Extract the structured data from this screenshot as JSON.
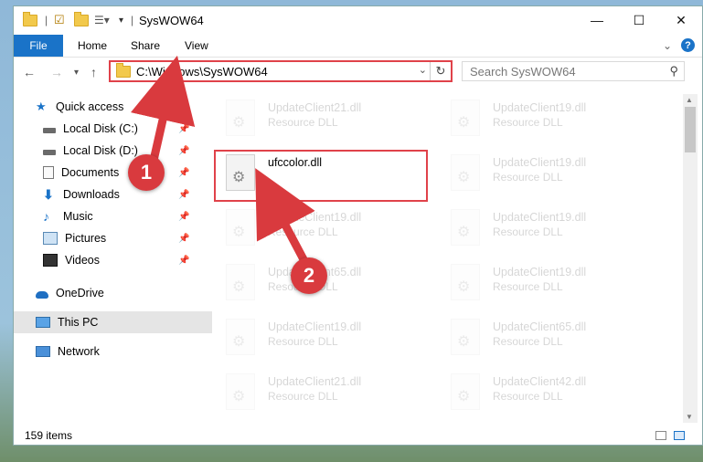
{
  "window": {
    "title": "SysWOW64",
    "controls": {
      "minimize": "—",
      "maximize": "☐",
      "close": "✕"
    }
  },
  "ribbon": {
    "tabs": [
      "File",
      "Home",
      "Share",
      "View"
    ]
  },
  "nav": {
    "address": "C:\\Windows\\SysWOW64",
    "search_placeholder": "Search SysWOW64"
  },
  "sidebar": {
    "items": [
      {
        "label": "Quick access",
        "icon": "star-icon"
      },
      {
        "label": "Local Disk (C:)",
        "icon": "drive-icon"
      },
      {
        "label": "Local Disk (D:)",
        "icon": "drive-icon"
      },
      {
        "label": "Documents",
        "icon": "documents-icon"
      },
      {
        "label": "Downloads",
        "icon": "download-icon"
      },
      {
        "label": "Music",
        "icon": "music-icon"
      },
      {
        "label": "Pictures",
        "icon": "pictures-icon"
      },
      {
        "label": "Videos",
        "icon": "videos-icon"
      },
      {
        "label": "OneDrive",
        "icon": "cloud-icon"
      },
      {
        "label": "This PC",
        "icon": "computer-icon"
      },
      {
        "label": "Network",
        "icon": "network-icon"
      }
    ]
  },
  "files": {
    "left": [
      {
        "name": "UpdateClient21.dll",
        "type": "Resource DLL"
      },
      {
        "name": "ufccolor.dll",
        "type": ""
      },
      {
        "name": "UpdateClient19.dll",
        "type": "Resource DLL"
      },
      {
        "name": "UpdateClient65.dll",
        "type": "Resource DLL"
      },
      {
        "name": "UpdateClient19.dll",
        "type": "Resource DLL"
      },
      {
        "name": "UpdateClient21.dll",
        "type": "Resource DLL"
      }
    ],
    "right": [
      {
        "name": "UpdateClient19.dll",
        "type": "Resource DLL"
      },
      {
        "name": "UpdateClient19.dll",
        "type": "Resource DLL"
      },
      {
        "name": "UpdateClient19.dll",
        "type": "Resource DLL"
      },
      {
        "name": "UpdateClient19.dll",
        "type": "Resource DLL"
      },
      {
        "name": "UpdateClient65.dll",
        "type": "Resource DLL"
      },
      {
        "name": "UpdateClient42.dll",
        "type": "Resource DLL"
      }
    ]
  },
  "status": {
    "items_count": "159 items"
  },
  "annotations": {
    "step1": "1",
    "step2": "2"
  },
  "colors": {
    "accent": "#1a73c8",
    "highlight": "#e0424a"
  }
}
